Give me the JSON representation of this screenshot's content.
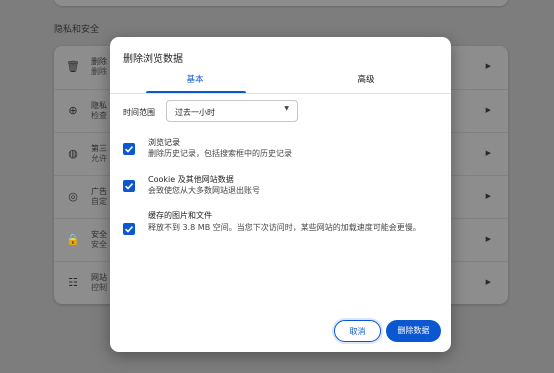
{
  "background": {
    "section_title": "隐私和安全",
    "rows": [
      {
        "icon": "trash-icon",
        "glyph": "🗑",
        "title": "删除",
        "subtitle": "删除"
      },
      {
        "icon": "privacy-guide-icon",
        "glyph": "⊕",
        "title": "隐私",
        "subtitle": "检查"
      },
      {
        "icon": "cookie-icon",
        "glyph": "◍",
        "title": "第三",
        "subtitle": "允许"
      },
      {
        "icon": "ad-privacy-icon",
        "glyph": "◎",
        "title": "广告",
        "subtitle": "自定"
      },
      {
        "icon": "lock-icon",
        "glyph": "🔒",
        "title": "安全",
        "subtitle": "安全"
      },
      {
        "icon": "sliders-icon",
        "glyph": "☷",
        "title": "网站",
        "subtitle": "控制"
      }
    ]
  },
  "dialog": {
    "title": "删除浏览数据",
    "tabs": {
      "basic": "基本",
      "advanced": "高级"
    },
    "time_range": {
      "label": "时间范围",
      "value": "过去一小时"
    },
    "options": [
      {
        "title": "浏览记录",
        "desc": "删除历史记录，包括搜索框中的历史记录",
        "checked": true
      },
      {
        "title": "Cookie 及其他网站数据",
        "desc": "会致使您从大多数网站退出账号",
        "checked": true
      },
      {
        "title": "缓存的图片和文件",
        "desc": "释放不到 3.8 MB 空间。当您下次访问时，某些网站的加载速度可能会更慢。",
        "checked": true
      }
    ],
    "buttons": {
      "cancel": "取消",
      "delete": "删除数据"
    }
  },
  "colors": {
    "accent": "#0b57d0",
    "overlay_bg": "#7d7d7d",
    "dialog_bg": "#ffffff"
  }
}
